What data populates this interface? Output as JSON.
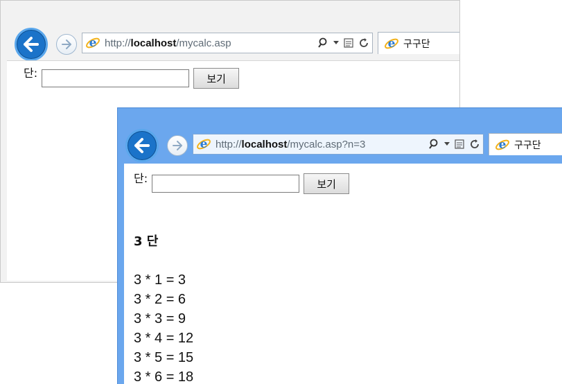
{
  "back_window": {
    "url_host": "localhost",
    "url_prefix": "http://",
    "url_path": "/mycalc.asp",
    "tab_title": "구구단",
    "form": {
      "label": "단:",
      "input_value": "",
      "button_label": "보기"
    }
  },
  "front_window": {
    "url_host": "localhost",
    "url_prefix": "http://",
    "url_path": "/mycalc.asp?n=3",
    "tab_title": "구구단",
    "form": {
      "label": "단:",
      "input_value": "",
      "button_label": "보기"
    },
    "result_title": "3 단",
    "result_lines": [
      "3 * 1 = 3",
      "3 * 2 = 6",
      "3 * 3 = 9",
      "3 * 4 = 12",
      "3 * 5 = 15",
      "3 * 6 = 18"
    ]
  },
  "icons": {
    "back": "back-arrow-icon",
    "forward": "forward-arrow-icon",
    "ie": "internet-explorer-icon",
    "search": "search-icon",
    "dropdown": "dropdown-arrow-icon",
    "compat": "compatibility-view-icon",
    "refresh": "refresh-icon"
  },
  "colors": {
    "back_button": "#1b73c9",
    "front_frame": "#6ba7ee",
    "ie_blue": "#2b7bd3",
    "ie_ring": "#f2b21b"
  }
}
